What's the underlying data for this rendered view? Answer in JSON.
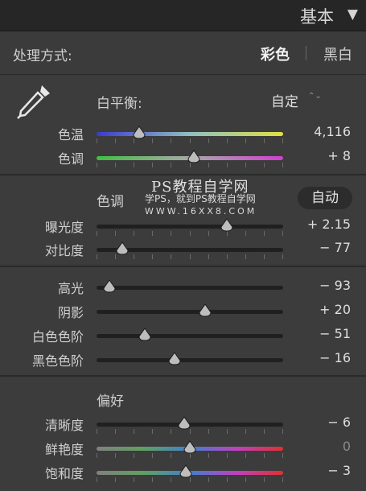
{
  "header": {
    "title": "基本",
    "arrow": "▼"
  },
  "treatment": {
    "label": "处理方式:",
    "option_color": "彩色",
    "option_bw": "黑白"
  },
  "white_balance": {
    "label": "白平衡:",
    "value": "自定",
    "spin": "⌃⌄"
  },
  "tone": {
    "title": "色调",
    "auto_label": "自动"
  },
  "presence": {
    "title": "偏好"
  },
  "watermark": {
    "line1": "PS教程自学网",
    "line2": "学PS，就到PS教程自学网",
    "line3": "WWW.16XX8.COM"
  },
  "sliders": {
    "temp": {
      "label": "色温",
      "value": "4,116",
      "level": 0.23
    },
    "tint": {
      "label": "色调",
      "value": "+ 8",
      "level": 0.52
    },
    "exposure": {
      "label": "曝光度",
      "value": "+ 2.15",
      "level": 0.7
    },
    "contrast": {
      "label": "对比度",
      "value": "− 77",
      "level": 0.14
    },
    "highlights": {
      "label": "高光",
      "value": "− 93",
      "level": 0.07
    },
    "shadows": {
      "label": "阴影",
      "value": "+ 20",
      "level": 0.58
    },
    "whites": {
      "label": "白色色阶",
      "value": "− 51",
      "level": 0.26
    },
    "blacks": {
      "label": "黑色色阶",
      "value": "− 16",
      "level": 0.42
    },
    "clarity": {
      "label": "清晰度",
      "value": "− 6",
      "level": 0.47
    },
    "vibrance": {
      "label": "鲜艳度",
      "value": "0",
      "level": 0.5
    },
    "saturation": {
      "label": "饱和度",
      "value": "− 3",
      "level": 0.48
    }
  },
  "colors": {
    "bg": "#3c3c3c",
    "header": "#262626",
    "text": "#cfcfcf"
  }
}
